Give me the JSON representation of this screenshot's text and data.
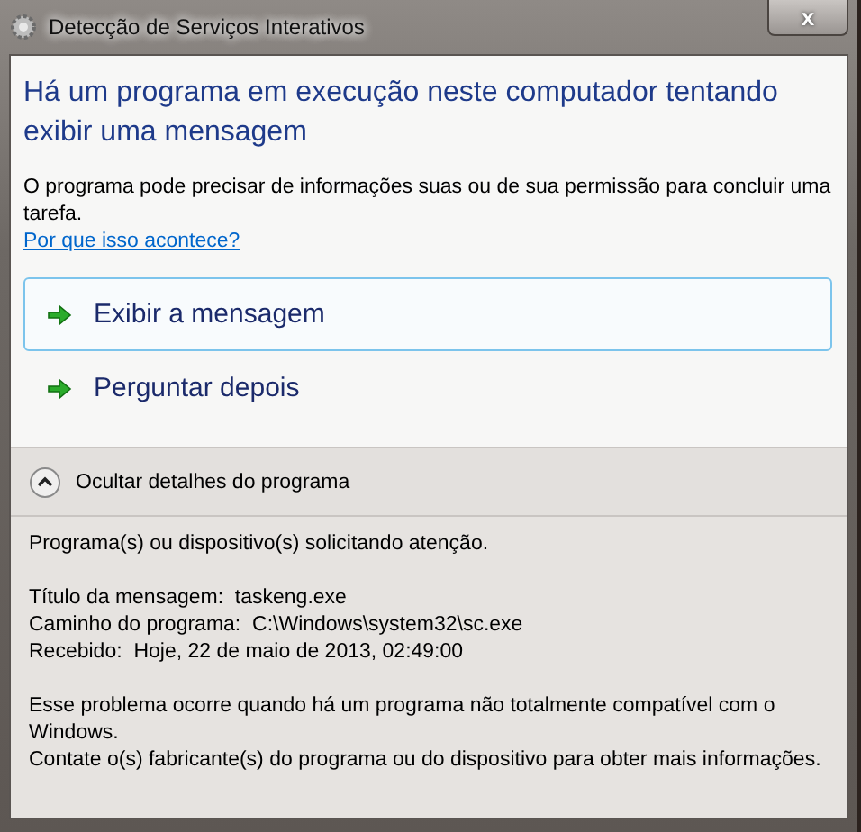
{
  "window": {
    "title": "Detecção de Serviços Interativos",
    "close_label": "x"
  },
  "heading": "Há um programa em execução neste computador tentando exibir uma mensagem",
  "description": "O programa pode precisar de informações suas ou de sua permissão para concluir uma tarefa.",
  "help_link": "Por que isso acontece?",
  "options": [
    {
      "label": "Exibir a mensagem",
      "selected": true
    },
    {
      "label": "Perguntar depois",
      "selected": false
    }
  ],
  "details_toggle": {
    "label": "Ocultar detalhes do programa",
    "expanded": true
  },
  "details": {
    "intro": "Programa(s) ou dispositivo(s) solicitando atenção.",
    "fields": [
      {
        "label": "Título da mensagem:",
        "value": "taskeng.exe"
      },
      {
        "label": "Caminho do programa:",
        "value": "C:\\Windows\\system32\\sc.exe"
      },
      {
        "label": "Recebido:",
        "value": "Hoje, 22 de maio de 2013, 02:49:00"
      }
    ],
    "notes": [
      "Esse problema ocorre quando há um programa não totalmente compatível com o Windows.",
      "Contate o(s) fabricante(s) do programa ou do dispositivo para obter mais informações."
    ]
  }
}
